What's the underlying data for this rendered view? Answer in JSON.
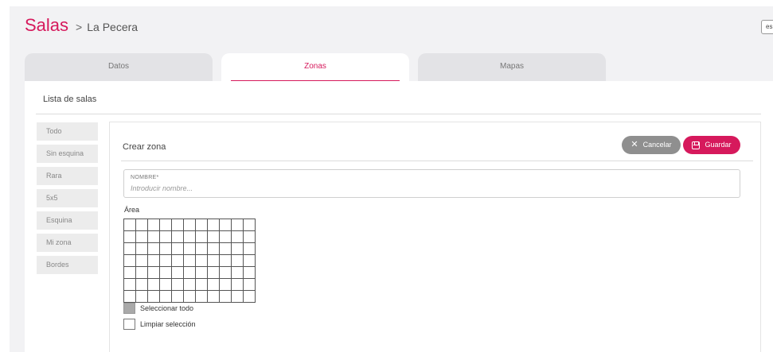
{
  "header": {
    "title": "Salas",
    "separator": ">",
    "subtitle": "La Pecera",
    "language": "es"
  },
  "tabs": [
    {
      "label": "Datos",
      "active": false
    },
    {
      "label": "Zonas",
      "active": true
    },
    {
      "label": "Mapas",
      "active": false
    }
  ],
  "list": {
    "title": "Lista de salas",
    "items": [
      {
        "label": "Todo"
      },
      {
        "label": "Sin esquina"
      },
      {
        "label": "Rara"
      },
      {
        "label": "5x5"
      },
      {
        "label": "Esquina"
      },
      {
        "label": "Mi zona"
      },
      {
        "label": "Bordes"
      }
    ]
  },
  "form": {
    "title": "Crear zona",
    "cancel_label": "Cancelar",
    "save_label": "Guardar",
    "name_label": "NOMBRE*",
    "name_value": "",
    "name_placeholder": "Introducir nombre...",
    "area_label": "Área",
    "grid": {
      "columns": 11,
      "rows": 7
    },
    "select_all_label": "Seleccionar todo",
    "clear_label": "Limpiar selección"
  },
  "colors": {
    "accent": "#d6195c",
    "cancel": "#8f8f8f",
    "background": "#f2f2f4"
  },
  "icons": {
    "cancel": "close-icon",
    "save": "floppy-disk-icon"
  }
}
